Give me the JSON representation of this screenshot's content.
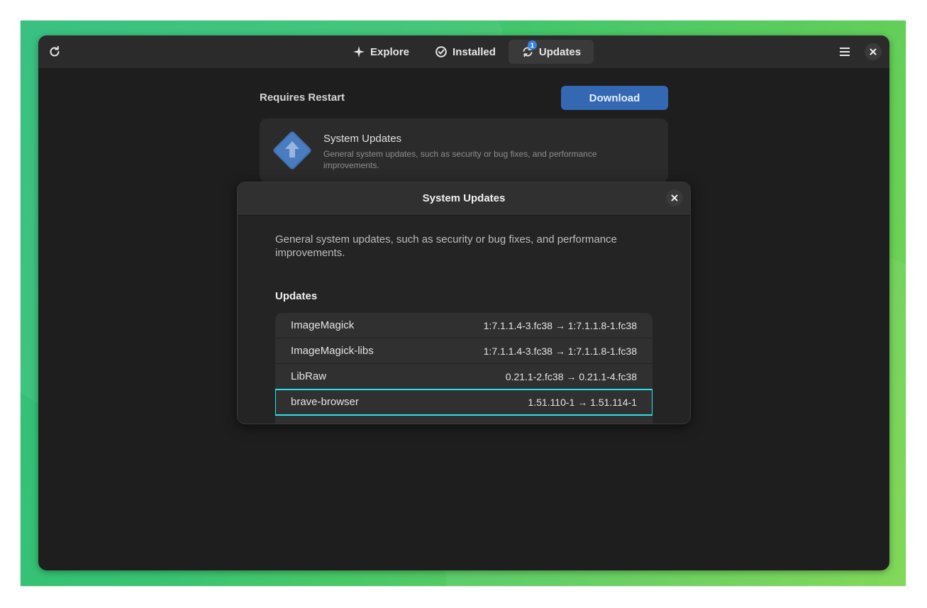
{
  "header": {
    "refresh_icon": "refresh-icon",
    "tabs": [
      {
        "label": "Explore",
        "icon": "explore-star-icon",
        "active": false
      },
      {
        "label": "Installed",
        "icon": "check-circle-icon",
        "active": false
      },
      {
        "label": "Updates",
        "icon": "updates-sync-icon",
        "active": true,
        "badge": "1"
      }
    ],
    "menu_icon": "hamburger-menu-icon",
    "close_icon": "close-icon"
  },
  "main": {
    "section_title": "Requires Restart",
    "download_label": "Download",
    "system_card": {
      "name": "System Updates",
      "description": "General system updates, such as security or bug fixes, and performance improvements."
    }
  },
  "dialog": {
    "title": "System Updates",
    "description": "General system updates, such as security or bug fixes, and performance improvements.",
    "updates_title": "Updates",
    "updates": [
      {
        "name": "ImageMagick",
        "version": "1:7.1.1.4-3.fc38 → 1:7.1.1.8-1.fc38"
      },
      {
        "name": "ImageMagick-libs",
        "version": "1:7.1.1.4-3.fc38 → 1:7.1.1.8-1.fc38"
      },
      {
        "name": "LibRaw",
        "version": "0.21.1-2.fc38 → 0.21.1-4.fc38"
      },
      {
        "name": "brave-browser",
        "version": "1.51.110-1 → 1.51.114-1"
      },
      {
        "name": "...",
        "version": "..."
      }
    ]
  },
  "colors": {
    "accent": "#3584e4",
    "download_button": "#3468b2",
    "focus_ring": "#27e3ec"
  }
}
